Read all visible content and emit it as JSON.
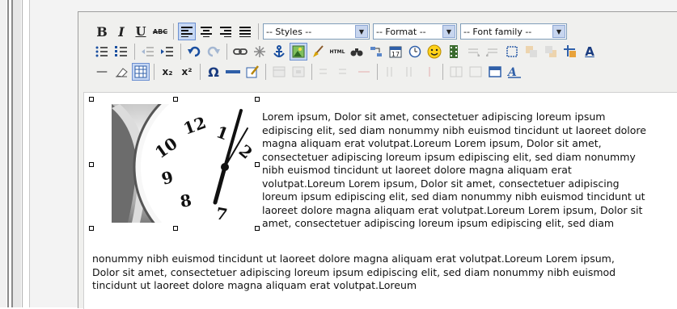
{
  "toolbar": {
    "row1": {
      "bold_label": "B",
      "italic_label": "I",
      "underline_label": "U",
      "strike_label": "ABC",
      "styles_select": "-- Styles --",
      "format_select": "-- Format --",
      "font_select": "-- Font family --",
      "select_arrow": "▼"
    },
    "row2": {
      "html_label": "HTML",
      "charmap_label": "Ω"
    },
    "row3": {
      "hr_label": "—",
      "sub_label": "x₂",
      "sup_label": "x²",
      "text_color_label": "A"
    }
  },
  "content": {
    "paragraph_wrapped": [
      "Lorem ipsum, Dolor sit amet, consectetuer adipiscing loreum ipsum",
      "edipiscing elit, sed diam nonummy nibh euismod tincidunt ut laoreet dolore",
      "magna aliquam erat volutpat.Loreum Lorem ipsum, Dolor sit amet,",
      "consectetuer adipiscing loreum ipsum edipiscing elit, sed diam nonummy",
      "nibh euismod tincidunt ut laoreet dolore magna aliquam erat",
      "volutpat.Loreum Lorem ipsum, Dolor sit amet, consectetuer adipiscing",
      "loreum ipsum edipiscing elit, sed diam nonummy nibh euismod tincidunt ut",
      "laoreet dolore magna aliquam erat volutpat.Loreum Lorem ipsum, Dolor sit",
      "amet, consectetuer adipiscing loreum ipsum edipiscing elit, sed diam"
    ],
    "paragraph_full": [
      "nonummy nibh euismod tincidunt ut laoreet dolore magna aliquam erat volutpat.Loreum Lorem ipsum,",
      "Dolor sit amet, consectetuer adipiscing loreum ipsum edipiscing elit, sed diam nonummy nibh euismod",
      "tincidunt ut laoreet dolore magna aliquam erat volutpat.Loreum"
    ],
    "clock_numerals": [
      "12",
      "1",
      "2",
      "10",
      "9",
      "8",
      "7"
    ]
  }
}
